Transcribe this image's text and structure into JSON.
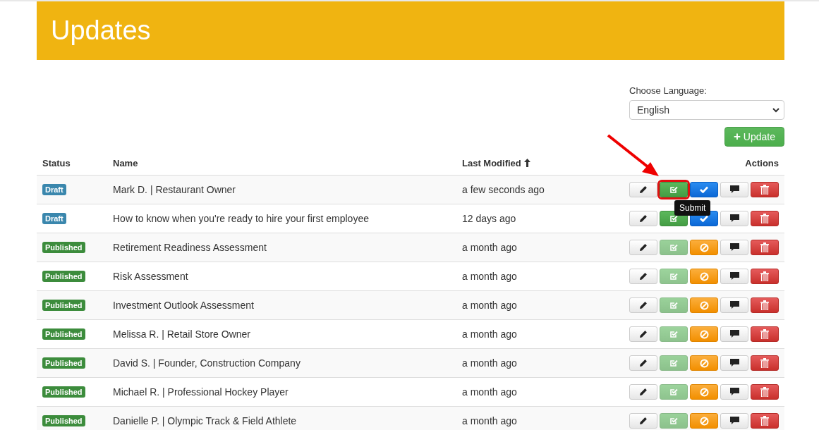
{
  "header": {
    "title": "Updates"
  },
  "language": {
    "label": "Choose Language:",
    "value": "English"
  },
  "add_button": {
    "icon": "+",
    "label": "Update"
  },
  "table": {
    "columns": [
      {
        "label": "Status",
        "sorted": false
      },
      {
        "label": "Name",
        "sorted": false
      },
      {
        "label": "Last Modified",
        "sorted": true
      },
      {
        "label": "Actions",
        "sorted": false
      }
    ],
    "rows": [
      {
        "status": "Draft",
        "kind": "draft",
        "name": "Mark D. | Restaurant Owner",
        "modified": "a few seconds ago",
        "submit_disabled": false,
        "submit_highlighted": true,
        "tooltip": "Submit"
      },
      {
        "status": "Draft",
        "kind": "draft",
        "name": "How to know when you're ready to hire your first employee",
        "modified": "12 days ago",
        "submit_disabled": false,
        "submit_highlighted": false
      },
      {
        "status": "Published",
        "kind": "published",
        "name": "Retirement Readiness Assessment",
        "modified": "a month ago",
        "submit_disabled": true,
        "submit_highlighted": false
      },
      {
        "status": "Published",
        "kind": "published",
        "name": "Risk Assessment",
        "modified": "a month ago",
        "submit_disabled": true,
        "submit_highlighted": false
      },
      {
        "status": "Published",
        "kind": "published",
        "name": "Investment Outlook Assessment",
        "modified": "a month ago",
        "submit_disabled": true,
        "submit_highlighted": false
      },
      {
        "status": "Published",
        "kind": "published",
        "name": "Melissa R. | Retail Store Owner",
        "modified": "a month ago",
        "submit_disabled": true,
        "submit_highlighted": false
      },
      {
        "status": "Published",
        "kind": "published",
        "name": "David S. | Founder, Construction Company",
        "modified": "a month ago",
        "submit_disabled": true,
        "submit_highlighted": false
      },
      {
        "status": "Published",
        "kind": "published",
        "name": "Michael R. | Professional Hockey Player",
        "modified": "a month ago",
        "submit_disabled": true,
        "submit_highlighted": false
      },
      {
        "status": "Published",
        "kind": "published",
        "name": "Danielle P. | Olympic Track & Field Athlete",
        "modified": "a month ago",
        "submit_disabled": true,
        "submit_highlighted": false
      }
    ]
  }
}
